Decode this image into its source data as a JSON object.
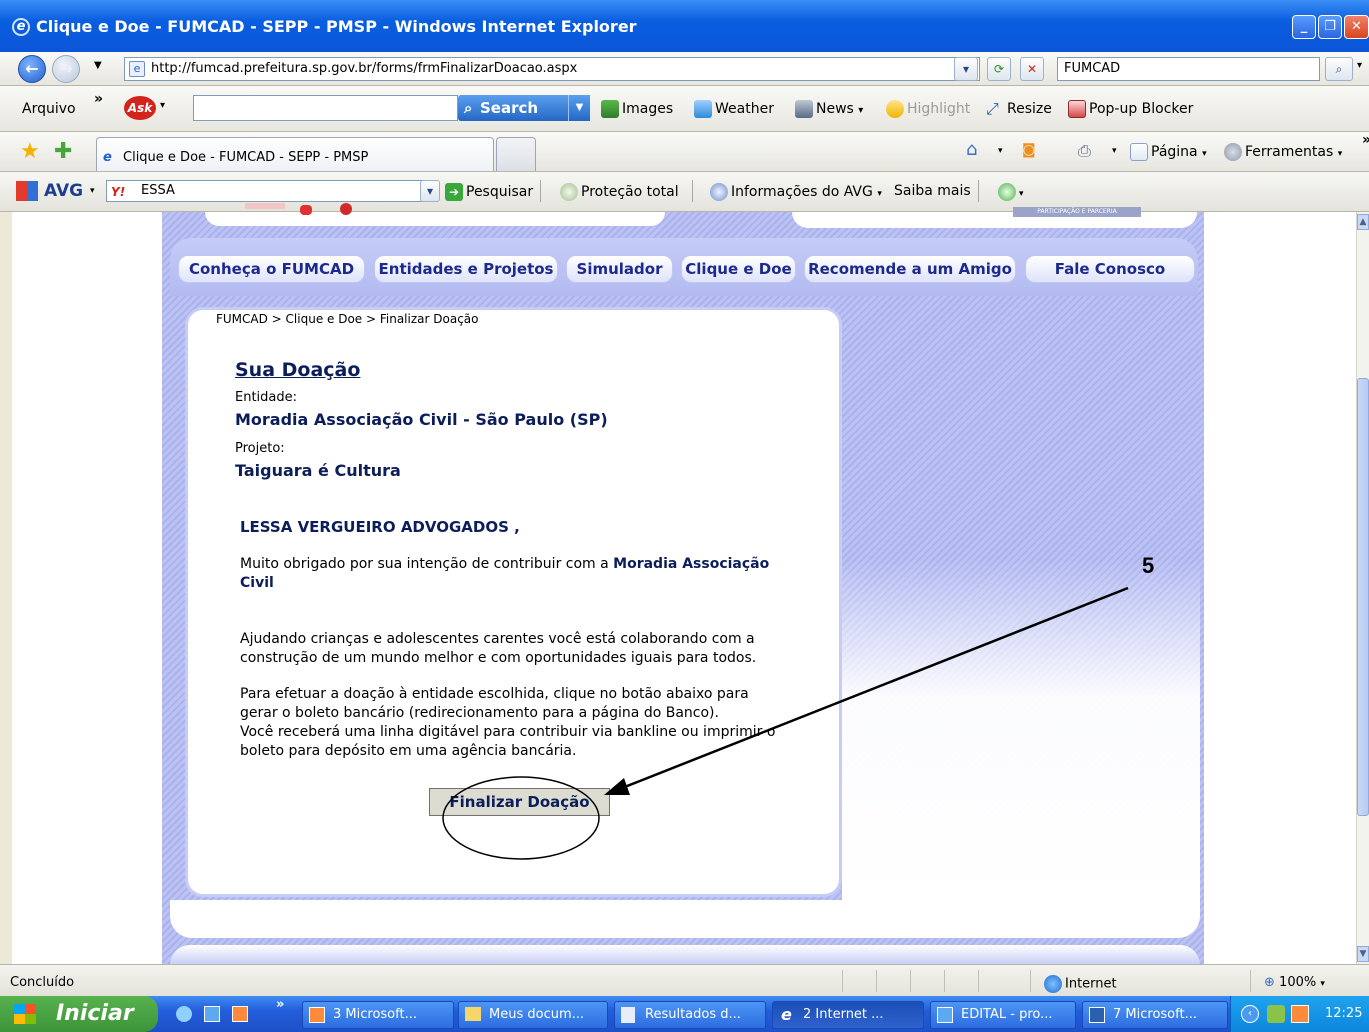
{
  "window": {
    "title": "Clique e Doe - FUMCAD - SEPP - PMSP - Windows Internet Explorer"
  },
  "address_bar": {
    "url": "http://fumcad.prefeitura.sp.gov.br/forms/frmFinalizarDoacao.aspx",
    "search_value": "FUMCAD"
  },
  "ask_toolbar": {
    "menu_label": "Arquivo",
    "chevron": "»",
    "ask_logo": "Ask",
    "search_value": "",
    "search_button": "Search",
    "items": [
      "Images",
      "Weather",
      "News",
      "Highlight",
      "Resize",
      "Pop-up Blocker"
    ]
  },
  "tabs_bar": {
    "active_tab": "Clique e Doe - FUMCAD - SEPP - PMSP",
    "commands": [
      "Página",
      "Ferramentas"
    ],
    "chevron": "»"
  },
  "avg_toolbar": {
    "logo": "AVG",
    "search_value": "ESSA",
    "items": [
      "Pesquisar",
      "Proteção total",
      "Informações do AVG",
      "Saiba mais"
    ]
  },
  "site": {
    "menu": [
      "Conheça o FUMCAD",
      "Entidades e Projetos",
      "Simulador",
      "Clique e Doe",
      "Recomende a um Amigo",
      "Fale Conosco"
    ],
    "breadcrumb": "FUMCAD > Clique e Doe > Finalizar Doação",
    "heading": "Sua Doação",
    "entity_label": "Entidade:",
    "entity_value": "Moradia Associação Civil - São Paulo (SP)",
    "project_label": "Projeto:",
    "project_value": "Taiguara é Cultura",
    "donor_name": "LESSA VERGUEIRO ADVOGADOS",
    "donor_comma": ",",
    "thanks_prefix": "Muito obrigado por sua intenção de contribuir com a",
    "thanks_entity_line1": "Moradia Associação",
    "thanks_entity_line2": "Civil",
    "para1_line1": "Ajudando crianças e adolescentes carentes você está colaborando com a",
    "para1_line2": "construção de um mundo melhor e com oportunidades iguais para todos.",
    "para2_line1": "Para efetuar a doação à entidade escolhida, clique no botão abaixo para",
    "para2_line2": "gerar o boleto bancário (redirecionamento para a página do Banco).",
    "para2_line3": "Você receberá uma linha digitável para contribuir via bankline ou imprimir o",
    "para2_line4": "boleto para depósito em uma agência bancária.",
    "finalize_button": "Finalizar Doação",
    "badge_text": "PARTICIPAÇÃO E PARCERIA"
  },
  "annotation": {
    "number": "5"
  },
  "status_bar": {
    "text": "Concluído",
    "zone": "Internet",
    "zoom": "100%"
  },
  "taskbar": {
    "start": "Iniciar",
    "chevron": "»",
    "tasks": [
      "3 Microsoft...",
      "Meus docum...",
      "Resultados d...",
      "2 Internet ...",
      "EDITAL - pro...",
      "7 Microsoft..."
    ],
    "clock": "12:25"
  },
  "colors": {
    "titlebar": "#0b55d8",
    "site_link": "#1b2a8c",
    "text_dark": "#0c1e5a",
    "taskbar": "#245edb",
    "start": "#3c9438"
  }
}
